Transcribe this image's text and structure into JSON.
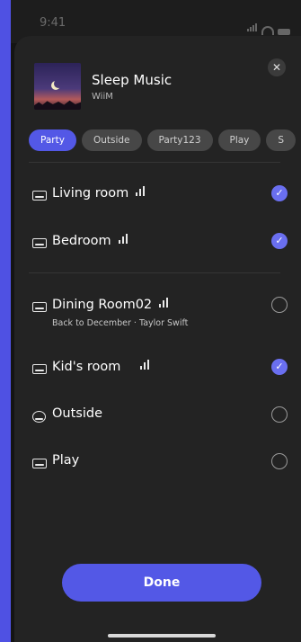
{
  "status": {
    "time": "9:41"
  },
  "header": {
    "title": "Sleep Music",
    "subtitle": "WiiM",
    "close_icon": "close-icon"
  },
  "groups": [
    "Party",
    "Outside",
    "Party123",
    "Play",
    "S"
  ],
  "active_group": "Party",
  "rooms": [
    {
      "name": "Living room",
      "playing": true,
      "selected": true,
      "icon": "soundbar-icon"
    },
    {
      "name": "Bedroom",
      "playing": true,
      "selected": true,
      "icon": "soundbar-icon"
    },
    {
      "name": "Dining Room02",
      "playing": true,
      "selected": false,
      "now_playing": "Back to December · Taylor Swift",
      "icon": "speaker-icon"
    },
    {
      "name": "Kid's room",
      "playing": true,
      "selected": true,
      "icon": "speaker-icon"
    },
    {
      "name": "Outside",
      "playing": false,
      "selected": false,
      "icon": "round-speaker-icon"
    },
    {
      "name": "Play",
      "playing": false,
      "selected": false,
      "icon": "speaker-icon"
    }
  ],
  "done_label": "Done",
  "colors": {
    "accent": "#5358e6",
    "background": "#4f51e3",
    "sheet": "#232323"
  }
}
